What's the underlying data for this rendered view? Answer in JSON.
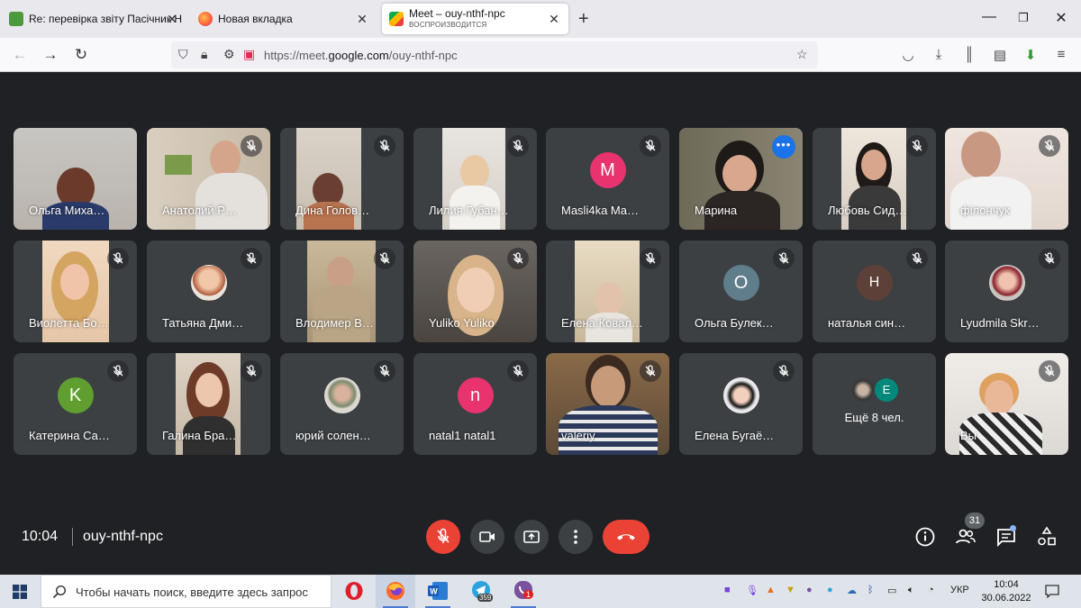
{
  "browser": {
    "tabs": [
      {
        "title": "Re: перевірка звіту Пасічник Н",
        "favicon": "mail-icon"
      },
      {
        "title": "Новая вкладка",
        "favicon": "firefox-icon"
      },
      {
        "title": "Meet – ouy-nthf-npc",
        "subtitle": "ВОСПРОИЗВОДИТСЯ",
        "favicon": "meet-icon"
      }
    ],
    "url_prefix": "https://meet.",
    "url_domain": "google.com",
    "url_path": "/ouy-nthf-npc"
  },
  "meeting": {
    "time": "10:04",
    "code": "ouy-nthf-npc",
    "participants_count": "31"
  },
  "tiles": [
    {
      "name": "Ольга Миха…",
      "type": "video",
      "muted": false
    },
    {
      "name": "Анатолий Р…",
      "type": "video",
      "muted": true
    },
    {
      "name": "Дина Голов…",
      "type": "video",
      "muted": true
    },
    {
      "name": "Лилия Губан…",
      "type": "video",
      "muted": true
    },
    {
      "name": "Masli4ka Ma…",
      "type": "avatar",
      "letter": "M",
      "color": "#e8336e",
      "muted": true
    },
    {
      "name": "Марина",
      "type": "video",
      "muted": false,
      "speaking": true
    },
    {
      "name": "Любовь Сид…",
      "type": "video",
      "muted": true
    },
    {
      "name": "філончук",
      "type": "video",
      "muted": true
    },
    {
      "name": "Виолетта Бо…",
      "type": "video",
      "muted": true
    },
    {
      "name": "Татьяна Дми…",
      "type": "photo-avatar",
      "muted": true
    },
    {
      "name": "Влодимер В…",
      "type": "video",
      "muted": true
    },
    {
      "name": "Yuliko Yuliko",
      "type": "video",
      "muted": true
    },
    {
      "name": "Елена Ковал…",
      "type": "video",
      "muted": true
    },
    {
      "name": "Ольга Булек…",
      "type": "avatar",
      "letter": "О",
      "color": "#607d8b",
      "muted": true
    },
    {
      "name": "наталья син…",
      "type": "avatar",
      "letter": "Н",
      "color": "#5d4037",
      "muted": true
    },
    {
      "name": "Lyudmila Skr…",
      "type": "photo-avatar",
      "muted": true
    },
    {
      "name": "Катерина Са…",
      "type": "avatar",
      "letter": "K",
      "color": "#5f9e2f",
      "muted": true
    },
    {
      "name": "Галина Бра…",
      "type": "video",
      "muted": true
    },
    {
      "name": "юрий солен…",
      "type": "photo-avatar",
      "muted": true
    },
    {
      "name": "natal1 natal1",
      "type": "avatar",
      "letter": "n",
      "color": "#e8336e",
      "muted": true
    },
    {
      "name": "valeriy",
      "type": "video",
      "muted": true
    },
    {
      "name": "Елена Бугаё…",
      "type": "photo-avatar",
      "muted": true
    },
    {
      "name": "Ещё 8 чел.",
      "type": "overflow",
      "letter": "E",
      "color": "#00897b"
    },
    {
      "name": "Вы",
      "type": "video",
      "muted": true
    }
  ],
  "taskbar": {
    "search_placeholder": "Чтобы начать поиск, введите здесь запрос",
    "telegram_badge": "359",
    "viber_badge": "1",
    "language": "УКР",
    "time": "10:04",
    "date": "30.06.2022"
  }
}
